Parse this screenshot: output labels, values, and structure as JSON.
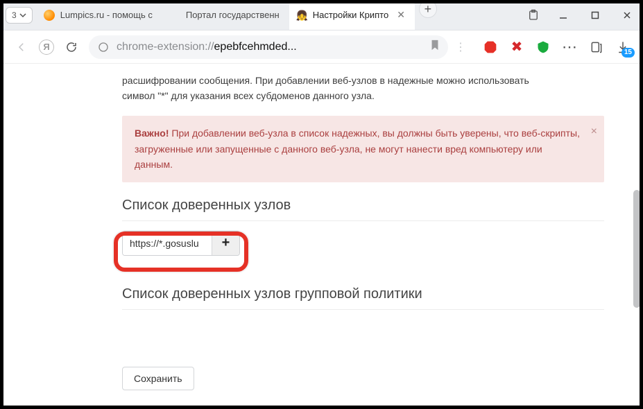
{
  "browser": {
    "tab_count": "3",
    "tabs": [
      {
        "label": "Lumpics.ru - помощь с",
        "active": false
      },
      {
        "label": "Портал государственн",
        "active": false
      },
      {
        "label": "Настройки Крипто",
        "active": true
      }
    ],
    "url_prefix": "chrome-extension://",
    "url_rest": "epebfcehmded...",
    "download_badge": "15"
  },
  "page": {
    "intro1": "расшифровании сообщения. При добавлении веб-узлов в надежные можно использовать",
    "intro2": "символ \"*\" для указания всех субдоменов данного узла.",
    "alert_strong": "Важно!",
    "alert_body": " При добавлении веб-узла в список надежных, вы должны быть уверены, что веб-скрипты, загруженные или запущенные с данного веб-узла, не могут нанести вред компьютеру или данным.",
    "section_trusted": "Список доверенных узлов",
    "section_gp": "Список доверенных узлов групповой политики",
    "host_input": "https://*.gosuslu",
    "save": "Сохранить"
  }
}
